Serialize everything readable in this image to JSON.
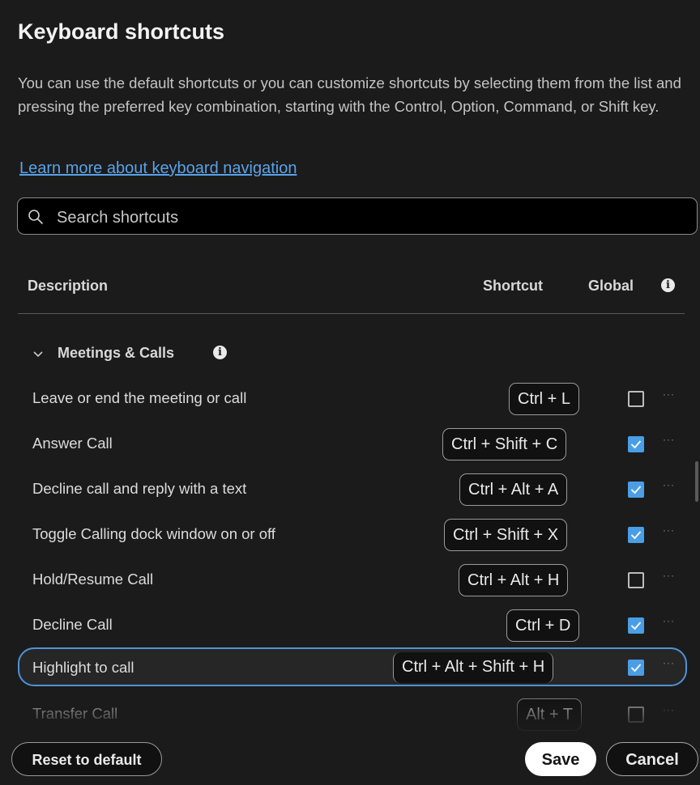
{
  "dialog": {
    "title": "Keyboard shortcuts",
    "description": "You can use the default shortcuts or you can customize shortcuts by selecting them from the list and pressing the preferred key combination, starting with the Control, Option, Command, or Shift key.",
    "learn_more": "Learn more about keyboard navigation"
  },
  "search": {
    "placeholder": "Search shortcuts",
    "value": ""
  },
  "table": {
    "col_description": "Description",
    "col_shortcut": "Shortcut",
    "col_global": "Global"
  },
  "section": {
    "label": "Meetings & Calls",
    "expanded": true
  },
  "rows": [
    {
      "label": "Leave or end the meeting or call",
      "shortcut": "Ctrl + L",
      "global": false
    },
    {
      "label": "Answer Call",
      "shortcut": "Ctrl + Shift + C",
      "global": true
    },
    {
      "label": "Decline call and reply with a text",
      "shortcut": "Ctrl + Alt + A",
      "global": true
    },
    {
      "label": "Toggle Calling dock window on or off",
      "shortcut": "Ctrl + Shift + X",
      "global": true
    },
    {
      "label": "Hold/Resume Call",
      "shortcut": "Ctrl + Alt + H",
      "global": false
    },
    {
      "label": "Decline Call",
      "shortcut": "Ctrl + D",
      "global": true
    },
    {
      "label": "Highlight to call",
      "shortcut": "Ctrl + Alt + Shift + H",
      "global": true,
      "selected": true
    },
    {
      "label": "Transfer Call",
      "shortcut": "Alt + T",
      "global": false
    }
  ],
  "more_glyph": "···",
  "footer": {
    "reset_label": "Reset to default",
    "save_label": "Save",
    "cancel_label": "Cancel"
  },
  "colors": {
    "background": "#1b1b1b",
    "accent": "#4a9ee6",
    "link": "#5aa2e8",
    "selection_border": "#4d93d9"
  }
}
